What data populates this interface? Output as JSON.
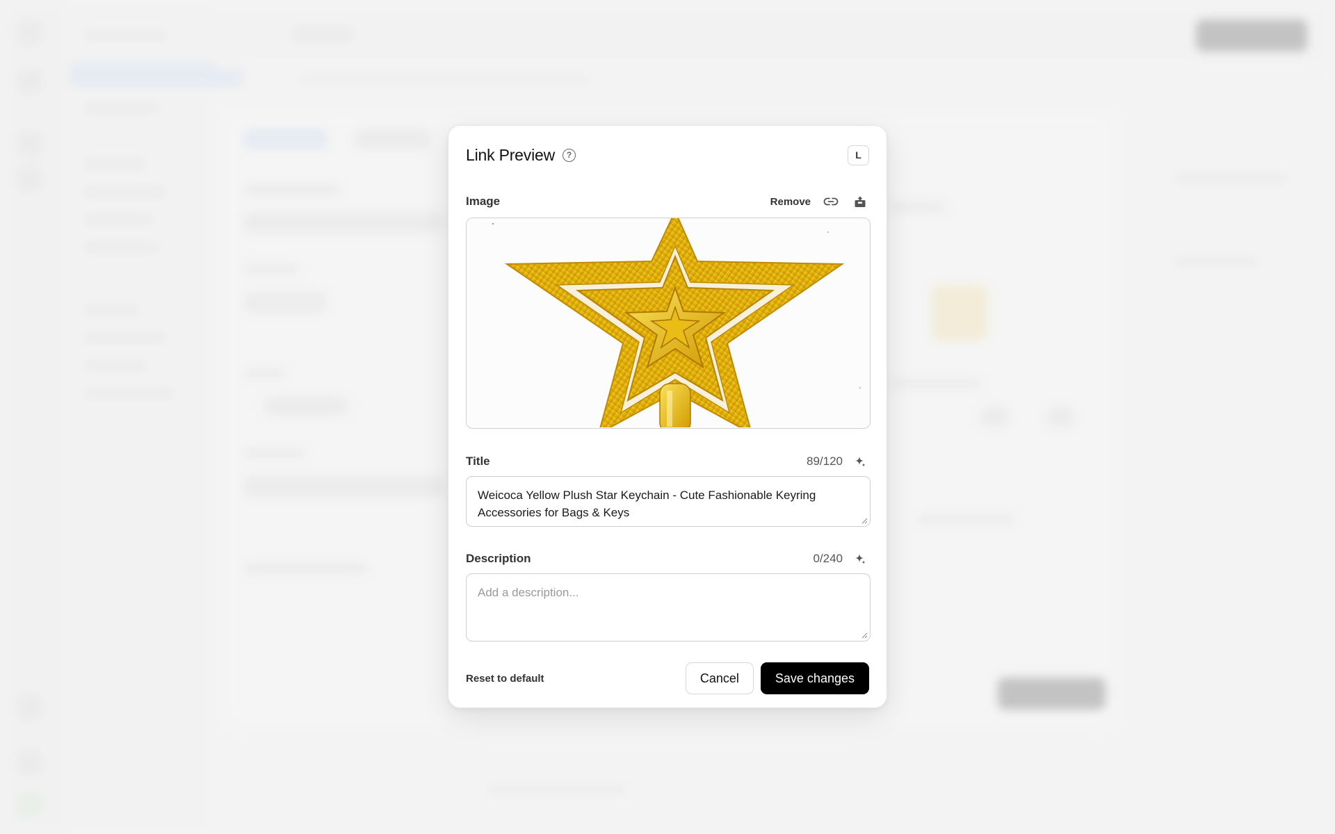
{
  "modal": {
    "title": "Link Preview",
    "shortcut_key": "L",
    "image_section": {
      "label": "Image",
      "remove_label": "Remove",
      "link_icon": "link-icon",
      "upload_icon": "upload-icon"
    },
    "title_field": {
      "label": "Title",
      "counter": "89/120",
      "value": "Weicoca Yellow Plush Star Keychain - Cute Fashionable Keyring Accessories for Bags & Keys",
      "ai_icon": "sparkle-icon"
    },
    "description_field": {
      "label": "Description",
      "counter": "0/240",
      "placeholder": "Add a description...",
      "value": "",
      "ai_icon": "sparkle-icon"
    },
    "footer": {
      "reset_label": "Reset to default",
      "cancel_label": "Cancel",
      "save_label": "Save changes"
    }
  },
  "colors": {
    "primary_button": "#000000",
    "star_gold": "#e8be10"
  }
}
